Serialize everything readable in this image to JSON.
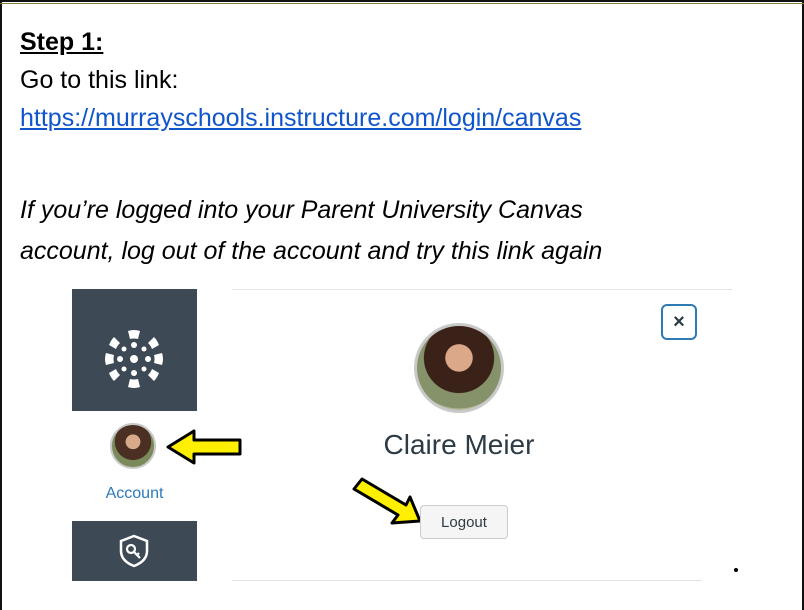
{
  "step": {
    "title": "Step 1:",
    "line1": "Go to this link:",
    "link": "https://murrayschools.instructure.com/login/canvas",
    "note_line1": "If you’re logged into your Parent University Canvas",
    "note_line2": "account, log out of the account and try this link again"
  },
  "screenshot": {
    "nav_account_label": "Account",
    "close_symbol": "×",
    "profile_name": "Claire Meier",
    "logout_label": "Logout",
    "nav_color": "#3d4a55",
    "link_color": "#2b7abc",
    "arrow_color": "#ffef00",
    "icons": [
      "canvas-logo-icon",
      "avatar",
      "arrow-icon",
      "close-icon",
      "shield-icon"
    ]
  }
}
